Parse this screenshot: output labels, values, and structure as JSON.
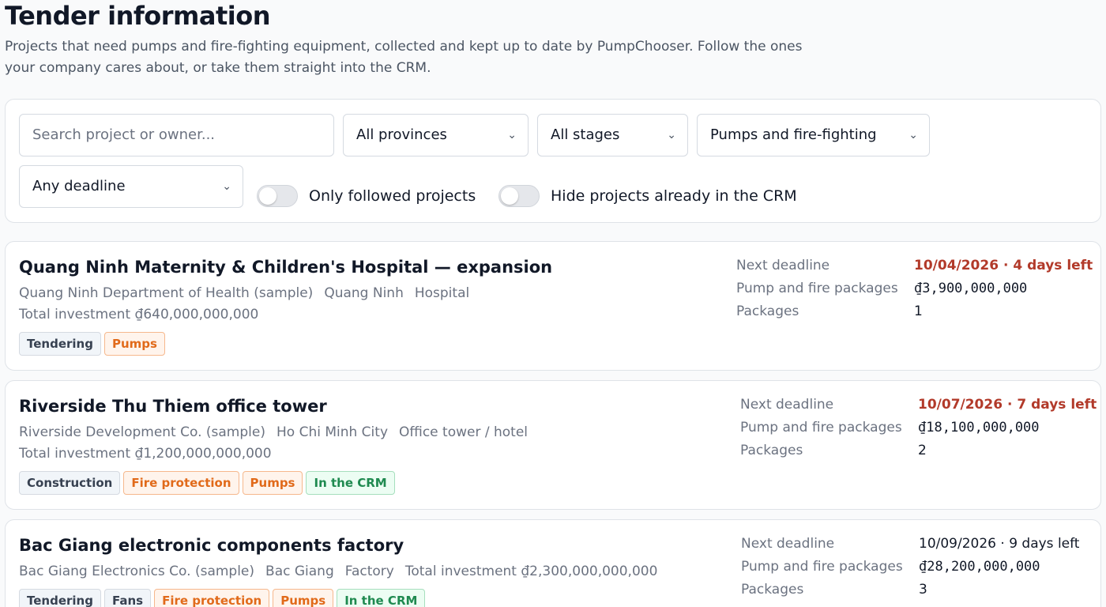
{
  "header": {
    "title": "Tender information",
    "description": "Projects that need pumps and fire-fighting equipment, collected and kept up to date by PumpChooser. Follow the ones your company cares about, or take them straight into the CRM."
  },
  "filters": {
    "search_placeholder": "Search project or owner...",
    "province": "All provinces",
    "stage": "All stages",
    "category": "Pumps and fire-fighting",
    "deadline": "Any deadline",
    "toggle_followed": "Only followed projects",
    "toggle_hide_crm": "Hide projects already in the CRM",
    "chevron_icon": "chevron-down-icon"
  },
  "labels": {
    "next_deadline": "Next deadline",
    "pump_fire_packages": "Pump and fire packages",
    "packages": "Packages"
  },
  "projects": [
    {
      "title": "Quang Ninh Maternity & Children's Hospital — expansion",
      "owner": "Quang Ninh Department of Health (sample)",
      "province": "Quang Ninh",
      "type": "Hospital",
      "investment": "Total investment ₫640,000,000,000",
      "deadline": "10/04/2026 · 4 days left",
      "deadline_urgent": true,
      "package_value": "₫3,900,000,000",
      "packages": "1",
      "tags": [
        "Tendering",
        "Pumps"
      ]
    },
    {
      "title": "Riverside Thu Thiem office tower",
      "owner": "Riverside Development Co. (sample)",
      "province": "Ho Chi Minh City",
      "type": "Office tower / hotel",
      "investment": "Total investment ₫1,200,000,000,000",
      "deadline": "10/07/2026 · 7 days left",
      "deadline_urgent": true,
      "package_value": "₫18,100,000,000",
      "packages": "2",
      "tags": [
        "Construction",
        "Fire protection",
        "Pumps",
        "In the CRM"
      ]
    },
    {
      "title": "Bac Giang electronic components factory",
      "owner": "Bac Giang Electronics Co. (sample)",
      "province": "Bac Giang",
      "type": "Factory",
      "investment": "Total investment ₫2,300,000,000,000",
      "deadline": "10/09/2026 · 9 days left",
      "deadline_urgent": false,
      "package_value": "₫28,200,000,000",
      "packages": "3",
      "tags": [
        "Tendering",
        "Fans",
        "Fire protection",
        "Pumps",
        "In the CRM"
      ]
    }
  ],
  "colors": {
    "urgent_deadline": "#b23a2a",
    "tag_orange": "#e16a1a",
    "tag_green": "#1f8a50"
  }
}
